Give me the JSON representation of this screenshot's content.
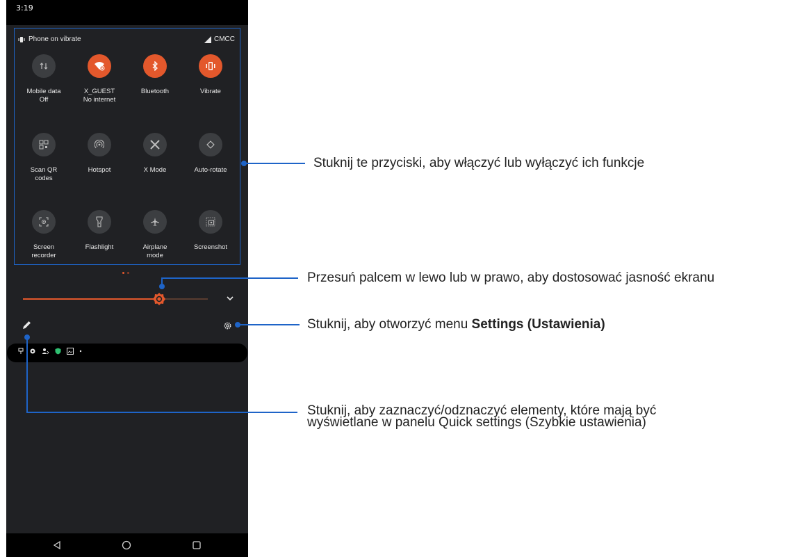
{
  "status": {
    "time": "3:19",
    "vibrate_text": "Phone on vibrate",
    "carrier": "CMCC"
  },
  "tiles": [
    {
      "label1": "Mobile data",
      "label2": "Off",
      "state": "off",
      "icon": "mobile-data-icon"
    },
    {
      "label1": "X_GUEST",
      "label2": "No internet",
      "state": "on",
      "icon": "wifi-icon"
    },
    {
      "label1": "Bluetooth",
      "label2": "",
      "state": "on",
      "icon": "bluetooth-icon"
    },
    {
      "label1": "Vibrate",
      "label2": "",
      "state": "on",
      "icon": "vibrate-icon"
    },
    {
      "label1": "Scan QR",
      "label2": "codes",
      "state": "off",
      "icon": "qr-code-icon"
    },
    {
      "label1": "Hotspot",
      "label2": "",
      "state": "off",
      "icon": "hotspot-icon"
    },
    {
      "label1": "X Mode",
      "label2": "",
      "state": "off",
      "icon": "x-mode-icon"
    },
    {
      "label1": "Auto-rotate",
      "label2": "",
      "state": "off",
      "icon": "auto-rotate-icon"
    },
    {
      "label1": "Screen",
      "label2": "recorder",
      "state": "off",
      "icon": "screen-recorder-icon"
    },
    {
      "label1": "Flashlight",
      "label2": "",
      "state": "off",
      "icon": "flashlight-icon"
    },
    {
      "label1": "Airplane",
      "label2": "mode",
      "state": "off",
      "icon": "airplane-icon"
    },
    {
      "label1": "Screenshot",
      "label2": "",
      "state": "off",
      "icon": "screenshot-icon"
    }
  ],
  "brightness": {
    "level": 0.74
  },
  "callouts": {
    "tiles": "Stuknij te przyciski, aby włączyć lub wyłączyć ich funkcje",
    "brightness": "Przesuń palcem w lewo lub w prawo, aby dostosować jasność ekranu",
    "settings_prefix": "Stuknij, aby otworzyć menu ",
    "settings_bold": "Settings (Ustawienia)",
    "edit_line1": "Stuknij, aby zaznaczyć/odznaczyć elementy, które mają być",
    "edit_line2": "wyświetlane w panelu Quick settings (Szybkie ustawienia)"
  },
  "colors": {
    "accent": "#e3582c",
    "callout": "#1e64c8",
    "tile_off": "#3c3e41",
    "panel_bg": "#202124"
  }
}
